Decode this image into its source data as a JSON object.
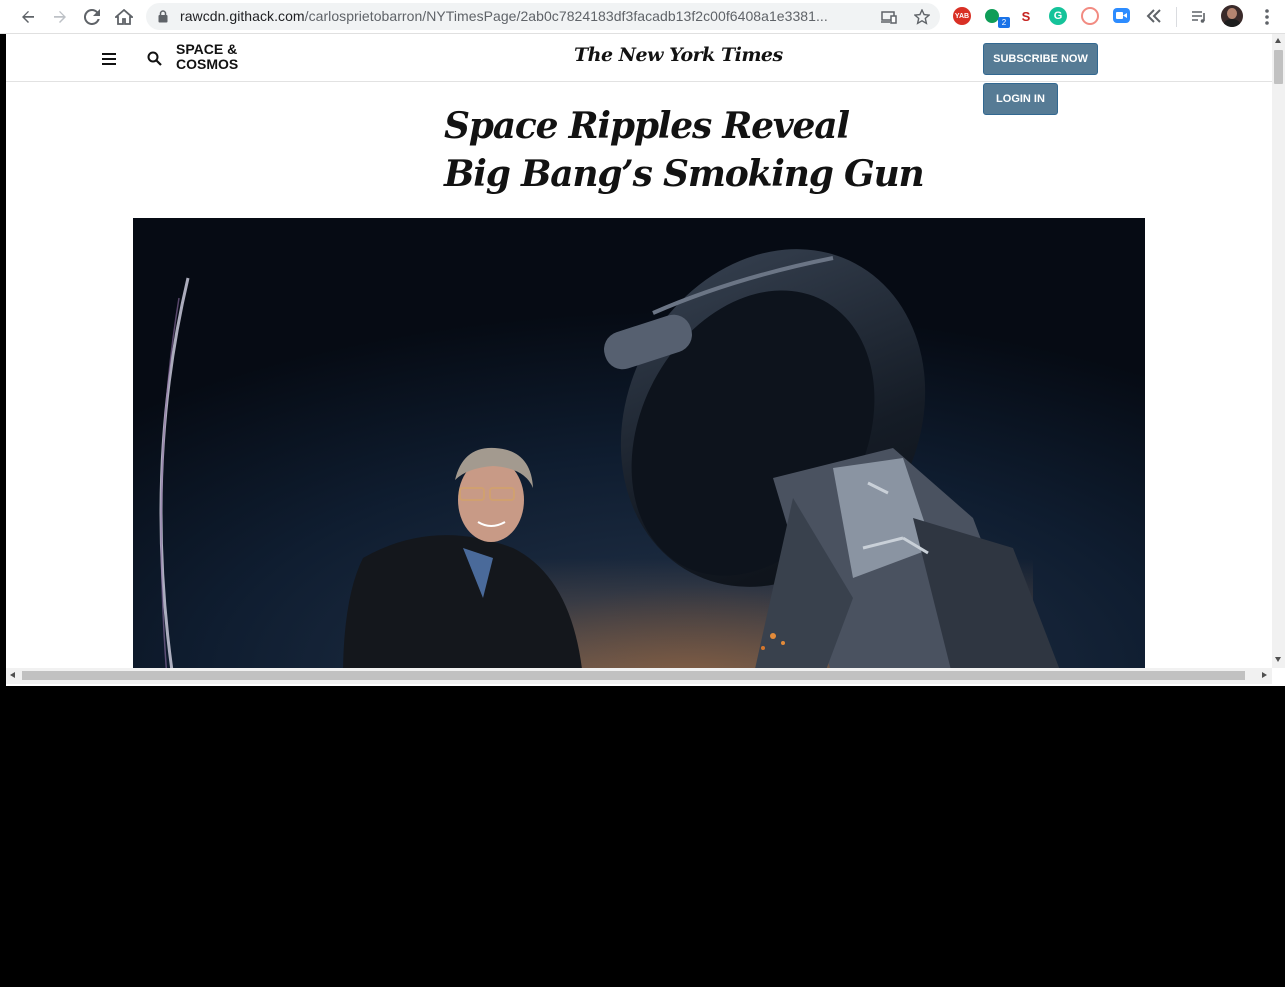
{
  "browser": {
    "url_host": "rawcdn.githack.com",
    "url_path": "/carlosprietobarron/NYTimesPage/2ab0c7824183df3facadb13f2c00f6408a1e3381...",
    "extension_badge": "2",
    "extensions": [
      "yab-icon",
      "green-dot-icon",
      "seo-icon",
      "grammarly-icon",
      "lastpass-icon",
      "zoom-icon",
      "back-arrow-ext-icon"
    ]
  },
  "site": {
    "section_line1": "SPACE &",
    "section_line2": "COSMOS",
    "logo": "The New York Times",
    "subscribe_label": "SUBSCRIBE NOW",
    "login_label": "LOGIN IN"
  },
  "article": {
    "headline_line1": "Space Ripples Reveal",
    "headline_line2": "Big Bang’s Smoking Gun",
    "hero_image": "man-with-telescope-photo"
  },
  "colors": {
    "button_bg": "#567b95",
    "text": "#121212",
    "page_bg": "#ffffff"
  }
}
